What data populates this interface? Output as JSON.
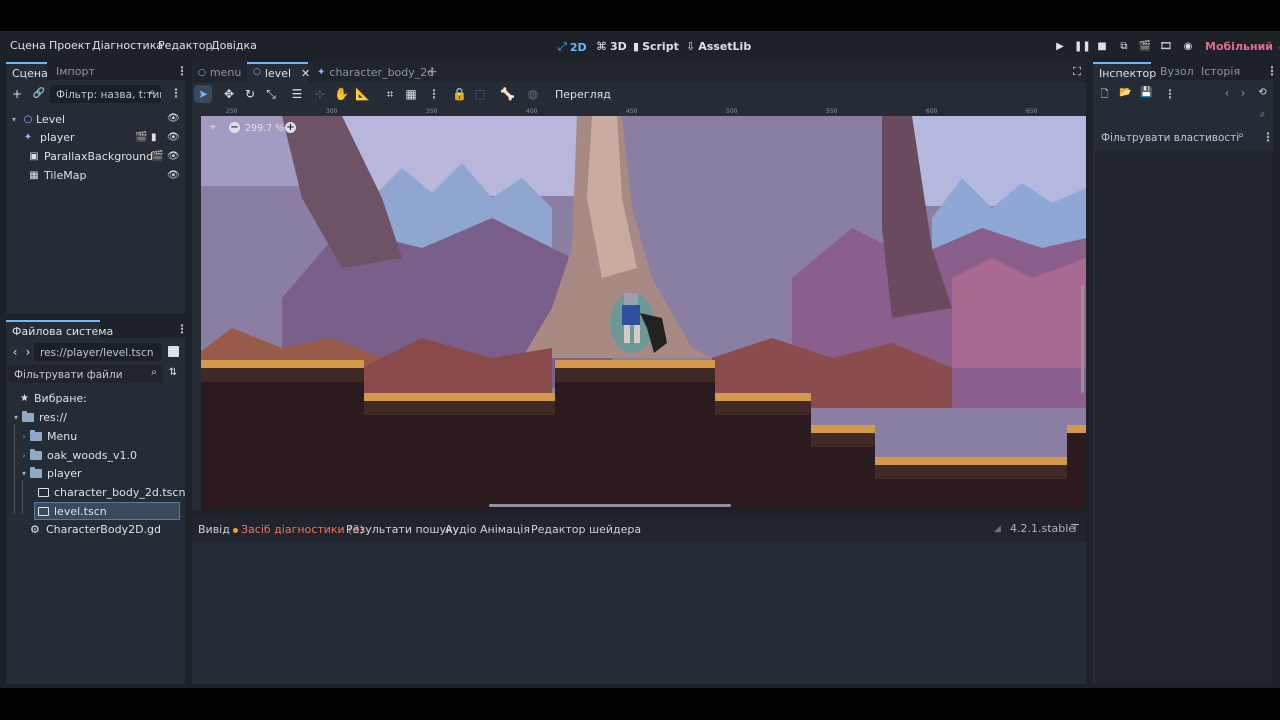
{
  "menubar": {
    "items": [
      "Сцена",
      "Проект",
      "Діагностика",
      "Редактор",
      "Довідка"
    ],
    "workspaces": [
      {
        "label": "2D",
        "icon": "2d-icon",
        "active": true
      },
      {
        "label": "3D",
        "icon": "3d-icon",
        "active": false
      },
      {
        "label": "Script",
        "icon": "script-icon",
        "active": false
      },
      {
        "label": "AssetLib",
        "icon": "assetlib-icon",
        "active": false
      }
    ],
    "renderer": "Мобільний",
    "renderer_color": "#e06b8d",
    "accent": "#6fb6ff"
  },
  "scene_dock": {
    "tabs": [
      "Сцена",
      "Імпорт"
    ],
    "filter_placeholder": "Фільтр: назва, t:тип,",
    "nodes": [
      {
        "name": "Level",
        "icon": "node2d-icon"
      },
      {
        "name": "player",
        "icon": "characterbody-icon"
      },
      {
        "name": "ParallaxBackground",
        "icon": "parallax-icon"
      },
      {
        "name": "TileMap",
        "icon": "tilemap-icon"
      }
    ]
  },
  "filesystem": {
    "title": "Файлова система",
    "path": "res://player/level.tscn",
    "filter_placeholder": "Фільтрувати файли",
    "favorites": "Вибране:",
    "root": "res://",
    "items": [
      {
        "name": "Menu",
        "type": "folder"
      },
      {
        "name": "oak_woods_v1.0",
        "type": "folder"
      },
      {
        "name": "player",
        "type": "folder"
      },
      {
        "name": "character_body_2d.tscn",
        "type": "scene"
      },
      {
        "name": "level.tscn",
        "type": "scene",
        "selected": true
      },
      {
        "name": "CharacterBody2D.gd",
        "type": "script"
      }
    ]
  },
  "editor_tabs": {
    "tabs": [
      {
        "label": "menu",
        "active": false
      },
      {
        "label": "level",
        "active": true
      },
      {
        "label": "character_body_2d",
        "active": false
      }
    ]
  },
  "toolbar": {
    "view_label": "Перегляд"
  },
  "viewport": {
    "zoom": "299.7 %",
    "ruler_top": [
      "250",
      "300",
      "350",
      "400",
      "450",
      "500",
      "550",
      "600",
      "650"
    ]
  },
  "bottom_panel": {
    "tabs": [
      "Вивід",
      "Засіб діагностики (3)",
      "Результати пошуку",
      "Аудіо",
      "Анімація",
      "Редактор шейдера"
    ],
    "version": "4.2.1.stable"
  },
  "inspector": {
    "tabs": [
      "Інспектор",
      "Вузол",
      "Історія"
    ],
    "filter_placeholder": "Фільтрувати властивості"
  }
}
